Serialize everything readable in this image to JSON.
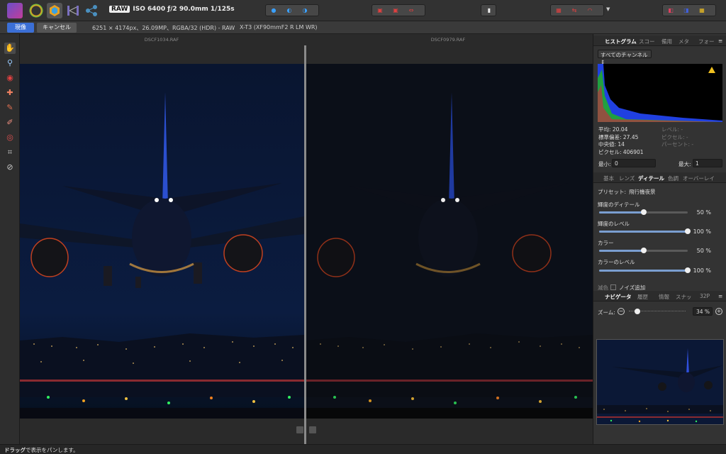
{
  "topbar": {
    "meta_badge": "RAW",
    "meta_text": "ISO 6400 ƒ/2 90.0mm 1/125s"
  },
  "context": {
    "develop_label": "現像",
    "cancel_label": "キャンセル",
    "image_info": "6251 × 4174px、26.09MP、RGBA/32 (HDR) - RAW",
    "lens_info": "X-T3 (XF90mmF2 R LM WR)"
  },
  "document": {
    "left_filename": "DSCF1034.RAF",
    "right_filename": "DSCF0979.RAF"
  },
  "histogram": {
    "tabs": [
      "ヒストグラム",
      "スコー",
      "備用",
      "メタ",
      "フォー"
    ],
    "channel": "すべてのチャンネル",
    "stats_left": [
      "平均: 20.04",
      "標準偏差: 27.45",
      "中央値: 14",
      "ピクセル: 406901"
    ],
    "stats_right": [
      "レベル: -",
      "ピクセル: -",
      "パーセント: -"
    ],
    "min_label": "最小:",
    "min_value": "0",
    "max_label": "最大:",
    "max_value": "1"
  },
  "develop_panel": {
    "tabs": [
      "基本",
      "レンズ",
      "ディテール",
      "色調",
      "オーバーレイ"
    ],
    "preset_label": "プリセット:",
    "preset_value": "飛行機夜景",
    "sliders": [
      {
        "label": "輝度のディテール",
        "value_text": "50 %",
        "value": 0.5
      },
      {
        "label": "輝度のレベル",
        "value_text": "100 %",
        "value": 1.0
      },
      {
        "label": "カラー",
        "value_text": "50 %",
        "value": 0.5
      },
      {
        "label": "カラーのレベル",
        "value_text": "100 %",
        "value": 1.0
      }
    ],
    "noise_label": "ノイズ追加",
    "noise_prefix": "減色"
  },
  "navigator": {
    "tabs": [
      "ナビゲータ",
      "履歴",
      "情報",
      "スナッ",
      "32P"
    ],
    "zoom_label": "ズーム:",
    "zoom_value": "34 %",
    "zoom_fraction": 0.1
  },
  "statusbar": {
    "bold": "ドラッグ",
    "text": "で表示をパンします。"
  },
  "colors": {
    "accent": "#3b6fd6",
    "sky_top": "#0a1630",
    "sky_bottom": "#0b1a3a"
  }
}
